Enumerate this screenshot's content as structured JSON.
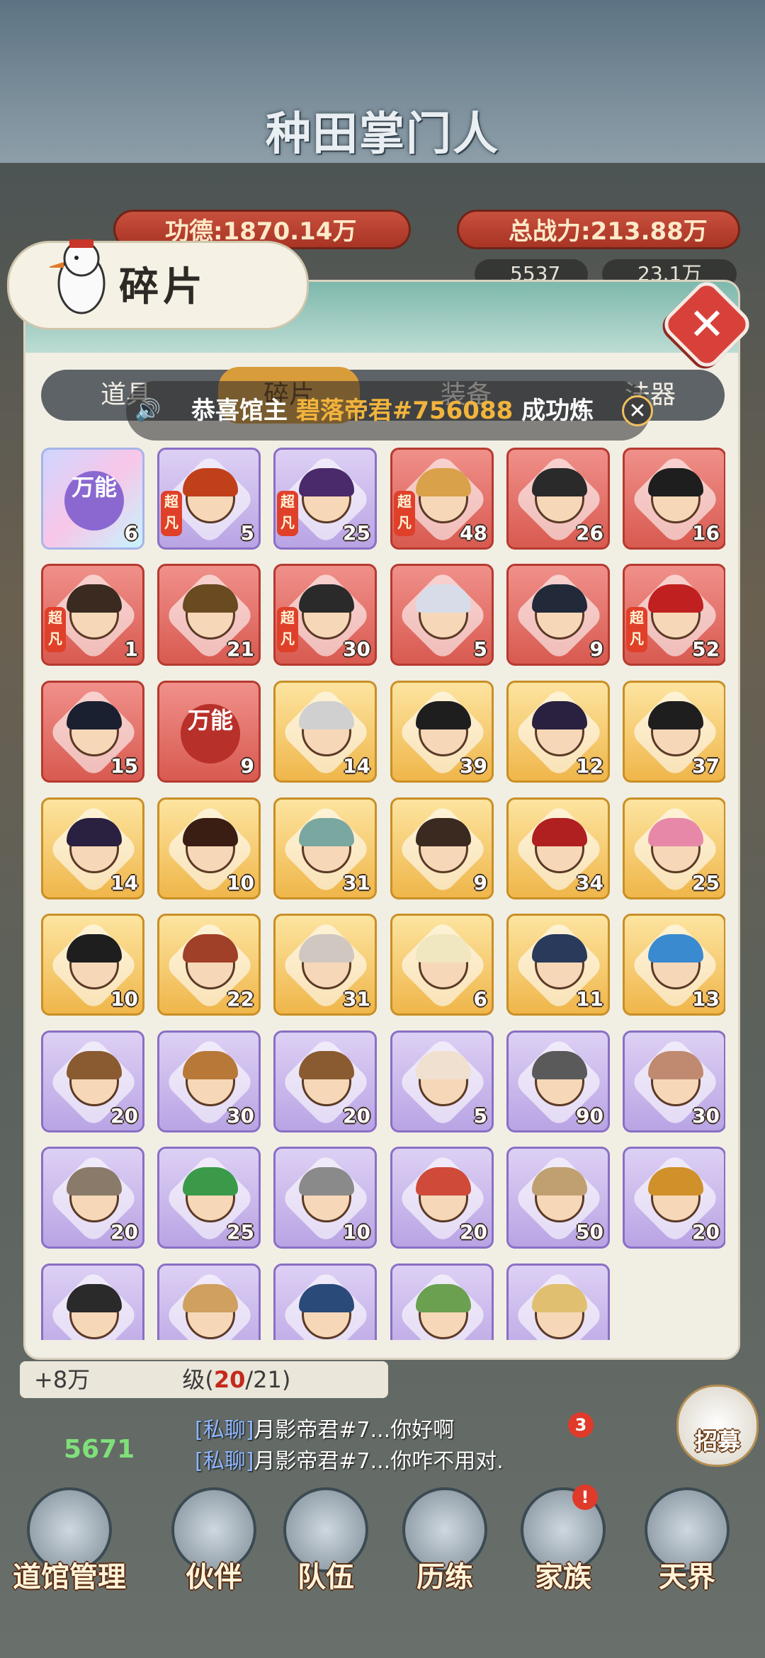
{
  "header": {
    "game_title": "种田掌门人",
    "merit_label": "功德:",
    "merit_value": "1870.14万",
    "power_label": "总战力:",
    "power_value": "213.88万",
    "resource_a": "5537",
    "resource_b": "23.1万"
  },
  "panel": {
    "title": "碎片",
    "tabs": [
      {
        "label": "道具",
        "active": false
      },
      {
        "label": "碎片",
        "active": true
      },
      {
        "label": "装备",
        "active": false
      },
      {
        "label": "法器",
        "active": false
      }
    ],
    "notice": {
      "prefix": "恭喜馆主",
      "name": "碧落帝君#756088",
      "suffix": "成功炼"
    }
  },
  "fragments": [
    {
      "rarity": "holo",
      "count": "6",
      "universal": true,
      "universal_text": "万能",
      "tag": ""
    },
    {
      "rarity": "purple",
      "count": "5",
      "tag": "超凡",
      "hair": "#c0401a"
    },
    {
      "rarity": "purple",
      "count": "25",
      "tag": "超凡",
      "hair": "#4a2a6a"
    },
    {
      "rarity": "red",
      "count": "48",
      "tag": "超凡",
      "hair": "#d9a24a"
    },
    {
      "rarity": "red",
      "count": "26",
      "tag": "",
      "hair": "#2a2a2a"
    },
    {
      "rarity": "red",
      "count": "16",
      "tag": "",
      "hair": "#1e1e1e"
    },
    {
      "rarity": "red",
      "count": "1",
      "tag": "超凡",
      "hair": "#3a2a20"
    },
    {
      "rarity": "red",
      "count": "21",
      "tag": "",
      "hair": "#6a4a20"
    },
    {
      "rarity": "red",
      "count": "30",
      "tag": "超凡",
      "hair": "#2a2a2a"
    },
    {
      "rarity": "red",
      "count": "5",
      "tag": "",
      "hair": "#d8dce8"
    },
    {
      "rarity": "red",
      "count": "9",
      "tag": "",
      "hair": "#222a3a"
    },
    {
      "rarity": "red",
      "count": "52",
      "tag": "超凡",
      "hair": "#c02020"
    },
    {
      "rarity": "red",
      "count": "15",
      "tag": "",
      "hair": "#1a2030"
    },
    {
      "rarity": "red",
      "count": "9",
      "universal": true,
      "universal_text": "万能",
      "tag": ""
    },
    {
      "rarity": "gold",
      "count": "14",
      "tag": "",
      "hair": "#d0d0d0"
    },
    {
      "rarity": "gold",
      "count": "39",
      "tag": "",
      "hair": "#1e1e1e"
    },
    {
      "rarity": "gold",
      "count": "12",
      "tag": "",
      "hair": "#2a2040"
    },
    {
      "rarity": "gold",
      "count": "37",
      "tag": "",
      "hair": "#1e1e1e"
    },
    {
      "rarity": "gold",
      "count": "14",
      "tag": "",
      "hair": "#2a2040"
    },
    {
      "rarity": "gold",
      "count": "10",
      "tag": "",
      "hair": "#3a1e14"
    },
    {
      "rarity": "gold",
      "count": "31",
      "tag": "",
      "hair": "#7aa8a0"
    },
    {
      "rarity": "gold",
      "count": "9",
      "tag": "",
      "hair": "#3a2a20"
    },
    {
      "rarity": "gold",
      "count": "34",
      "tag": "",
      "hair": "#b02020"
    },
    {
      "rarity": "gold",
      "count": "25",
      "tag": "",
      "hair": "#e888a8"
    },
    {
      "rarity": "gold",
      "count": "10",
      "tag": "",
      "hair": "#1e1e1e"
    },
    {
      "rarity": "gold",
      "count": "22",
      "tag": "",
      "hair": "#a04028"
    },
    {
      "rarity": "gold",
      "count": "31",
      "tag": "",
      "hair": "#d0c8c0"
    },
    {
      "rarity": "gold",
      "count": "6",
      "tag": "",
      "hair": "#f0e6c0"
    },
    {
      "rarity": "gold",
      "count": "11",
      "tag": "",
      "hair": "#2a3a5a"
    },
    {
      "rarity": "gold",
      "count": "13",
      "tag": "",
      "hair": "#3a8ad0"
    },
    {
      "rarity": "purple",
      "count": "20",
      "tag": "",
      "hair": "#8a5a30"
    },
    {
      "rarity": "purple",
      "count": "30",
      "tag": "",
      "hair": "#b87838"
    },
    {
      "rarity": "purple",
      "count": "20",
      "tag": "",
      "hair": "#8a5a30"
    },
    {
      "rarity": "purple",
      "count": "5",
      "tag": "",
      "hair": "#f0e0d0"
    },
    {
      "rarity": "purple",
      "count": "90",
      "tag": "",
      "hair": "#5a5a5a"
    },
    {
      "rarity": "purple",
      "count": "30",
      "tag": "",
      "hair": "#c08a70"
    },
    {
      "rarity": "purple",
      "count": "20",
      "tag": "",
      "hair": "#8a7a6a"
    },
    {
      "rarity": "purple",
      "count": "25",
      "tag": "",
      "hair": "#3a9a4a"
    },
    {
      "rarity": "purple",
      "count": "10",
      "tag": "",
      "hair": "#8a8a8a"
    },
    {
      "rarity": "purple",
      "count": "20",
      "tag": "",
      "hair": "#d04a3a"
    },
    {
      "rarity": "purple",
      "count": "50",
      "tag": "",
      "hair": "#c0a070"
    },
    {
      "rarity": "purple",
      "count": "20",
      "tag": "",
      "hair": "#d0902a"
    },
    {
      "rarity": "purple",
      "count": "",
      "tag": "",
      "hair": "#2a2a2a"
    },
    {
      "rarity": "purple",
      "count": "",
      "tag": "",
      "hair": "#d0a060"
    },
    {
      "rarity": "purple",
      "count": "",
      "tag": "",
      "hair": "#2a4a7a"
    },
    {
      "rarity": "purple",
      "count": "",
      "tag": "",
      "hair": "#6aa050"
    },
    {
      "rarity": "purple",
      "count": "",
      "tag": "",
      "hair": "#e0c070"
    }
  ],
  "bottom": {
    "income": "+8万",
    "level_prefix": "级(",
    "level_current": "20",
    "level_total": "/21)",
    "green_count": "5671",
    "chat": [
      {
        "tag": "[私聊]",
        "text": "月影帝君#7...你好啊"
      },
      {
        "tag": "[私聊]",
        "text": "月影帝君#7...你咋不用对."
      }
    ],
    "chat_badge": "3",
    "recruit_label": "招募",
    "nav": [
      {
        "label": "道馆管理"
      },
      {
        "label": "伙伴"
      },
      {
        "label": "队伍"
      },
      {
        "label": "历练"
      },
      {
        "label": "家族"
      },
      {
        "label": "天界"
      }
    ]
  }
}
